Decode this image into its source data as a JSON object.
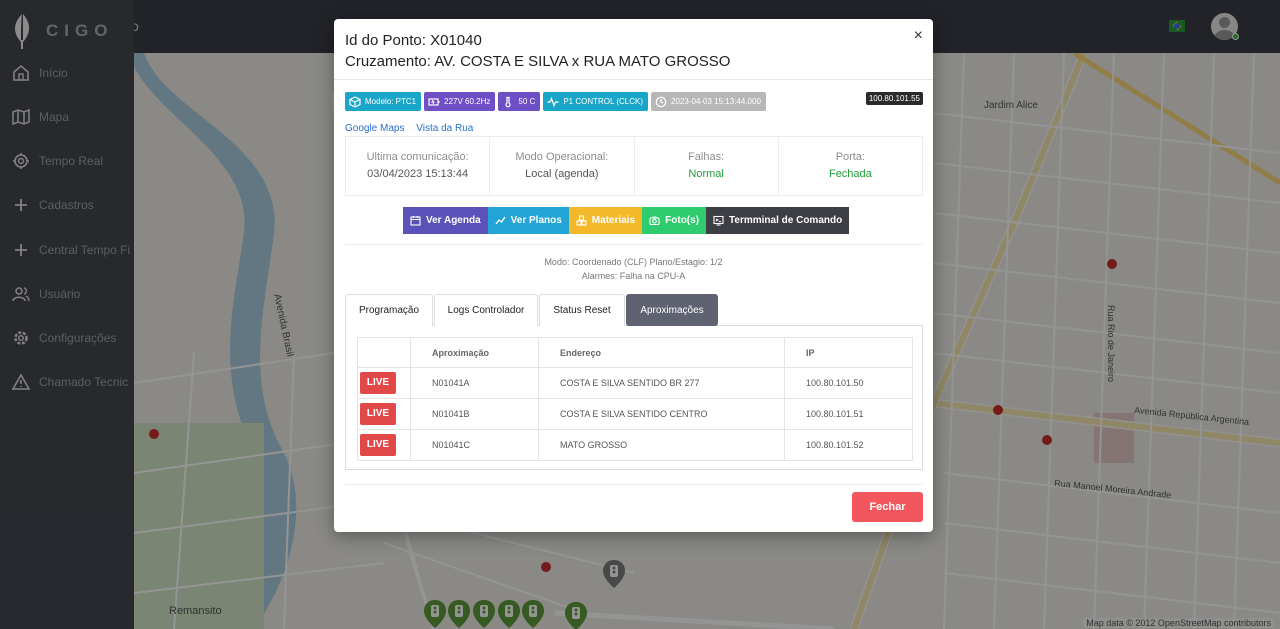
{
  "app": {
    "logo_text": "CIGO",
    "topbar_fragment": "o"
  },
  "sidebar": {
    "items": [
      {
        "label": "Início",
        "icon": "home-icon"
      },
      {
        "label": "Mapa",
        "icon": "map-icon"
      },
      {
        "label": "Tempo Real",
        "icon": "realtime-icon"
      },
      {
        "label": "Cadastros",
        "icon": "plus-icon"
      },
      {
        "label": "Central Tempo Fi",
        "icon": "plus-icon"
      },
      {
        "label": "Usuário",
        "icon": "users-icon"
      },
      {
        "label": "Configurações",
        "icon": "gear-icon"
      },
      {
        "label": "Chamado Tecnic",
        "icon": "warning-icon"
      }
    ]
  },
  "map": {
    "labels": [
      "Jardim Alice",
      "Remansito",
      "Avenida Brasil",
      "Avenida República Argentina",
      "Rua Manoel Moreira Andrade",
      "Rua Rio de Janeiro"
    ],
    "attribution": "Map data © 2012 OpenStreetMap contributors"
  },
  "modal": {
    "id_label": "Id do Ponto:",
    "id_value": "X01040",
    "cross_label": "Cruzamento:",
    "cross_value": "AV. COSTA E SILVA x RUA MATO GROSSO",
    "close_symbol": "×",
    "ip_tag": "100.80.101.55",
    "badges": [
      {
        "text": "Modelo: PTC1",
        "icon": "cube-icon",
        "color": "#1aa6c9"
      },
      {
        "text": "227V 60.2Hz",
        "icon": "battery-icon",
        "color": "#6f4fc6"
      },
      {
        "text": "50 C",
        "icon": "thermometer-icon",
        "color": "#6f4fc6"
      },
      {
        "text": "P1 CONTROL (CLCK)",
        "icon": "pulse-icon",
        "color": "#1aa6c9"
      },
      {
        "text": "2023-04-03 15:13:44.000",
        "icon": "clock-icon",
        "color": "#b7b7b7"
      }
    ],
    "links": [
      "Google Maps",
      "Vista da Rua"
    ],
    "info": [
      {
        "title": "Ultima comunicação:",
        "value": "03/04/2023 15:13:44",
        "green": false
      },
      {
        "title": "Modo Operacional:",
        "value": "Local (agenda)",
        "green": false
      },
      {
        "title": "Falhas:",
        "value": "Normal",
        "green": true
      },
      {
        "title": "Porta:",
        "value": "Fechada",
        "green": true
      }
    ],
    "actions": [
      {
        "label": "Ver Agenda",
        "icon": "calendar-icon",
        "color": "#5a52b8"
      },
      {
        "label": "Ver Planos",
        "icon": "chart-line-icon",
        "color": "#22a4d6"
      },
      {
        "label": "Materiais",
        "icon": "boxes-icon",
        "color": "#f3b92a"
      },
      {
        "label": "Foto(s)",
        "icon": "camera-icon",
        "color": "#2ecc6e"
      },
      {
        "label": "Termminal de Comando",
        "icon": "terminal-icon",
        "color": "#3d3f45"
      }
    ],
    "modo_line": "Modo: Coordenado (CLF) Plano/Estagio: 1/2",
    "alarm_line": "Alarmes: Falha na CPU-A",
    "tabs": [
      "Programação",
      "Logs Controlador",
      "Status Reset",
      "Aproximações"
    ],
    "active_tab": "Aproximações",
    "table": {
      "headers": [
        "",
        "Aproximação",
        "Endereço",
        "IP"
      ],
      "live_label": "LIVE",
      "rows": [
        {
          "aprox": "N01041A",
          "endereco": "COSTA E SILVA SENTIDO BR 277",
          "ip": "100.80.101.50"
        },
        {
          "aprox": "N01041B",
          "endereco": "COSTA E SILVA SENTIDO CENTRO",
          "ip": "100.80.101.51"
        },
        {
          "aprox": "N01041C",
          "endereco": "MATO GROSSO",
          "ip": "100.80.101.52"
        }
      ]
    },
    "close_button": "Fechar"
  }
}
